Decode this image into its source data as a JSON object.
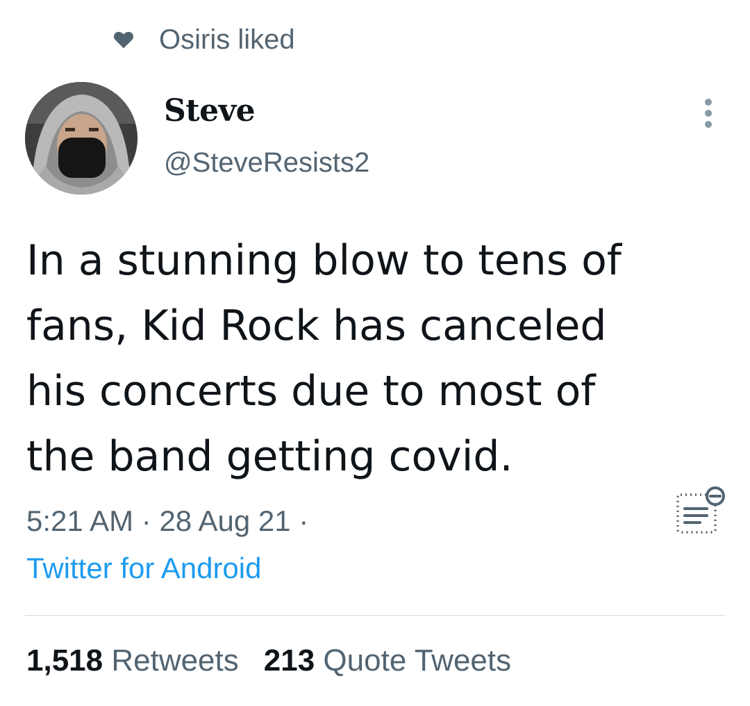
{
  "social_context": {
    "icon": "heart-icon",
    "text": "Osiris liked"
  },
  "author": {
    "display_name": "Steve",
    "handle": "@SteveResists2",
    "avatar": "avatar-photo"
  },
  "more_icon": "more-vertical-icon",
  "tweet": {
    "text": "In a stunning blow to tens of\nfans, Kid Rock has canceled\nhis concerts due to most of\nthe band getting covid.",
    "time": "5:21 AM",
    "separator": "·",
    "date": "28 Aug 21",
    "trailing_separator": "·",
    "source": "Twitter for Android",
    "source_color": "#1d9bf0"
  },
  "note_icon": "notes-list-icon",
  "stats": {
    "retweets_count": "1,518",
    "retweets_label": "Retweets",
    "quotes_count": "213",
    "quotes_label": "Quote Tweets"
  }
}
